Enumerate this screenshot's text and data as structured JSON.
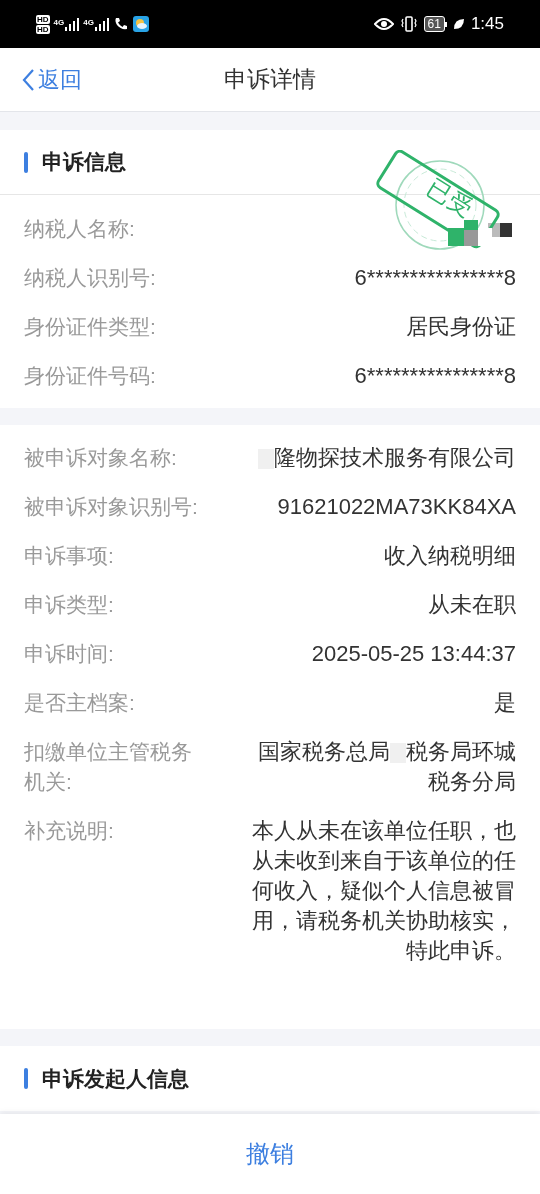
{
  "status_bar": {
    "sim_labels": [
      "HD",
      "HD"
    ],
    "networks": [
      "4G",
      "4G"
    ],
    "battery": "61",
    "time": "1:45"
  },
  "nav": {
    "back": "返回",
    "title": "申诉详情"
  },
  "sections": [
    {
      "title": "申诉信息",
      "stamp": {
        "text": "已受"
      },
      "rows": [
        {
          "label": "纳税人名称:",
          "segments": [
            {
              "kind": "mask"
            }
          ]
        },
        {
          "label": "纳税人识别号:",
          "segments": [
            {
              "kind": "text",
              "text": "6****************8"
            }
          ]
        },
        {
          "label": "身份证件类型:",
          "segments": [
            {
              "kind": "text",
              "text": "居民身份证"
            }
          ]
        },
        {
          "label": "身份证件号码:",
          "segments": [
            {
              "kind": "text",
              "text": "6****************8"
            }
          ]
        }
      ]
    },
    {
      "rows": [
        {
          "label": "被申诉对象名称:",
          "segments": [
            {
              "kind": "mask"
            },
            {
              "kind": "text",
              "text": "隆物探技术服务有限公司"
            }
          ]
        },
        {
          "label": "被申诉对象识别号:",
          "segments": [
            {
              "kind": "text",
              "text": "91621022MA73KK84XA"
            }
          ]
        },
        {
          "label": "申诉事项:",
          "segments": [
            {
              "kind": "text",
              "text": "收入纳税明细"
            }
          ]
        },
        {
          "label": "申诉类型:",
          "segments": [
            {
              "kind": "text",
              "text": "从未在职"
            }
          ]
        },
        {
          "label": "申诉时间:",
          "segments": [
            {
              "kind": "text",
              "text": "2025-05-25 13:44:37"
            }
          ]
        },
        {
          "label": "是否主档案:",
          "segments": [
            {
              "kind": "text",
              "text": "是"
            }
          ]
        },
        {
          "label": "扣缴单位主管税务机关:",
          "segments": [
            {
              "kind": "text",
              "text": "国家税务总局"
            },
            {
              "kind": "mask"
            },
            {
              "kind": "text",
              "text": "税务局环城税务分局"
            }
          ]
        },
        {
          "label": "补充说明:",
          "segments": [
            {
              "kind": "text",
              "text": "本人从未在该单位任职，也从未收到来自于该单位的任何收入，疑似个人信息被冒用，请税务机关协助核实，特此申诉。"
            }
          ]
        }
      ]
    },
    {
      "title": "申诉发起人信息"
    }
  ],
  "bottom_button": "撤销"
}
